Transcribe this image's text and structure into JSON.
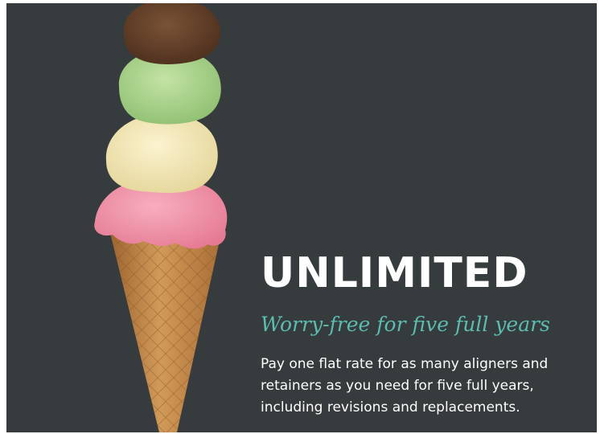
{
  "promo": {
    "headline": "UNLIMITED",
    "tagline": "Worry-free for five full years",
    "body_lines": [
      "Pay one flat rate for as many aligners and",
      "retainers as you need for five full years,",
      "including revisions and replacements."
    ]
  },
  "colors": {
    "background": "#363b3d",
    "tagline": "#5cbcb0",
    "text": "#ffffff",
    "scoop_chocolate": "#5b3a26",
    "scoop_pistachio": "#a9d38a",
    "scoop_vanilla": "#f2e6b4",
    "scoop_strawberry": "#f08ca4",
    "cone": "#c58d4d"
  },
  "image": {
    "subject": "ice-cream-cone-four-scoops"
  }
}
